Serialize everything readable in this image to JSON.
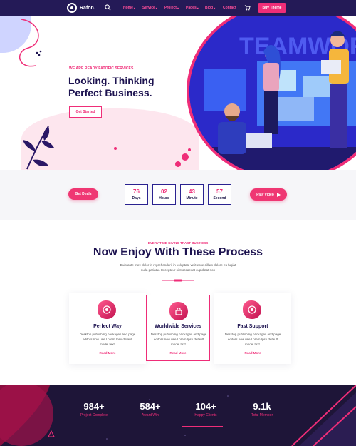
{
  "nav": {
    "logo_text": "Rafon.",
    "menu": [
      {
        "label": "Home",
        "chevron": "▾"
      },
      {
        "label": "Service",
        "chevron": "▾"
      },
      {
        "label": "Project",
        "chevron": "▾"
      },
      {
        "label": "Pages",
        "chevron": "▾"
      },
      {
        "label": "Blog",
        "chevron": "▾"
      },
      {
        "label": "Contact",
        "chevron": ""
      }
    ],
    "buy_label": "Buy Theme"
  },
  "hero": {
    "kicker": "WE ARE READY FATOFIC SERVICES",
    "title": "Looking. Thinking Perfect Business.",
    "cta": "Get Started",
    "wall_text": "TEAMWORK"
  },
  "countdown": {
    "deals_label": "Get Deals",
    "items": [
      {
        "value": "76",
        "label": "Days"
      },
      {
        "value": "02",
        "label": "Hours"
      },
      {
        "value": "43",
        "label": "Minute"
      },
      {
        "value": "57",
        "label": "Second"
      }
    ],
    "play_label": "Play video"
  },
  "process": {
    "kicker": "EVERY TIME GIVING TRAST BUSINESS",
    "title": "Now Enjoy With These Process",
    "description": "Duis aute irure dolor in reprehenderit in voluptate velit esse cillum dolore eu fugiat nulla pariatur. Excepteur sint occaecat cupidatat non",
    "cards": [
      {
        "title": "Perfect Way",
        "text": "Desktop publishing packages and page editors now use Lorem Ipsu default model text.",
        "link": "Read More",
        "icon": "target-icon"
      },
      {
        "title": "Worldwide Services",
        "text": "Desktop publishing packages and page editors now use Lorem Ipsu default model text.",
        "link": "Read More",
        "icon": "lock-icon"
      },
      {
        "title": "Fast Support",
        "text": "Desktop publishing packages and page editors now use Lorem Ipsu default model text.",
        "link": "Read More",
        "icon": "target-icon"
      }
    ]
  },
  "stats": [
    {
      "value": "984+",
      "label": "Project Complete"
    },
    {
      "value": "584+",
      "label": "Award Win"
    },
    {
      "value": "104+",
      "label": "Happy Clients"
    },
    {
      "value": "9.1k",
      "label": "Total Member"
    }
  ],
  "colors": {
    "accent": "#ef2d78",
    "navy": "#241a57",
    "dark": "#1e1538",
    "blue": "#2d2ad9"
  }
}
